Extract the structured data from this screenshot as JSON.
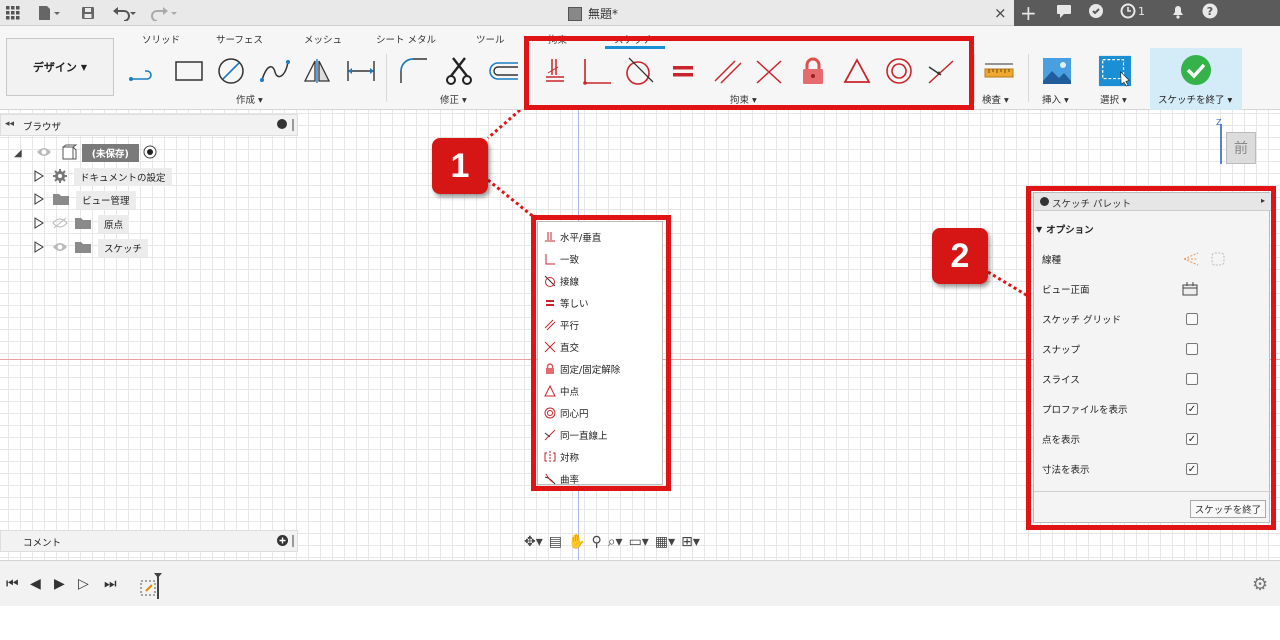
{
  "titlebar": {
    "doc_title": "無題*",
    "close": "×",
    "notification_count": "1"
  },
  "ribbon": {
    "workspace": "デザイン",
    "tabs": [
      "ソリッド",
      "サーフェス",
      "メッシュ",
      "シート メタル",
      "ツール",
      "拘束",
      "スケッチ"
    ],
    "groups": {
      "create": "作成",
      "modify": "修正",
      "constraints": "拘束",
      "inspect": "検査",
      "insert": "挿入",
      "select": "選択",
      "finish": "スケッチを終了"
    }
  },
  "browser": {
    "title": "ブラウザ",
    "root": "(未保存)",
    "items": [
      "ドキュメントの設定",
      "ビュー管理",
      "原点",
      "スケッチ"
    ]
  },
  "comments": {
    "title": "コメント"
  },
  "viewcube": {
    "label": "前",
    "axis": "Z"
  },
  "callouts": {
    "one": "1",
    "two": "2"
  },
  "constraint_list": [
    "水平/垂直",
    "一致",
    "接線",
    "等しい",
    "平行",
    "直交",
    "固定/固定解除",
    "中点",
    "同心円",
    "同一直線上",
    "対称",
    "曲率"
  ],
  "palette": {
    "title": "スケッチ パレット",
    "section": "オプション",
    "rows": [
      {
        "label": "線種"
      },
      {
        "label": "ビュー正面"
      },
      {
        "label": "スケッチ グリッド",
        "checked": false
      },
      {
        "label": "スナップ",
        "checked": false
      },
      {
        "label": "スライス",
        "checked": false
      },
      {
        "label": "プロファイルを表示",
        "checked": true
      },
      {
        "label": "点を表示",
        "checked": true
      },
      {
        "label": "寸法を表示",
        "checked": true
      }
    ],
    "finish_button": "スケッチを終了"
  },
  "colors": {
    "accent": "#1a8fd6",
    "callout_red": "#e01414",
    "constraint_red": "#c8262c"
  }
}
